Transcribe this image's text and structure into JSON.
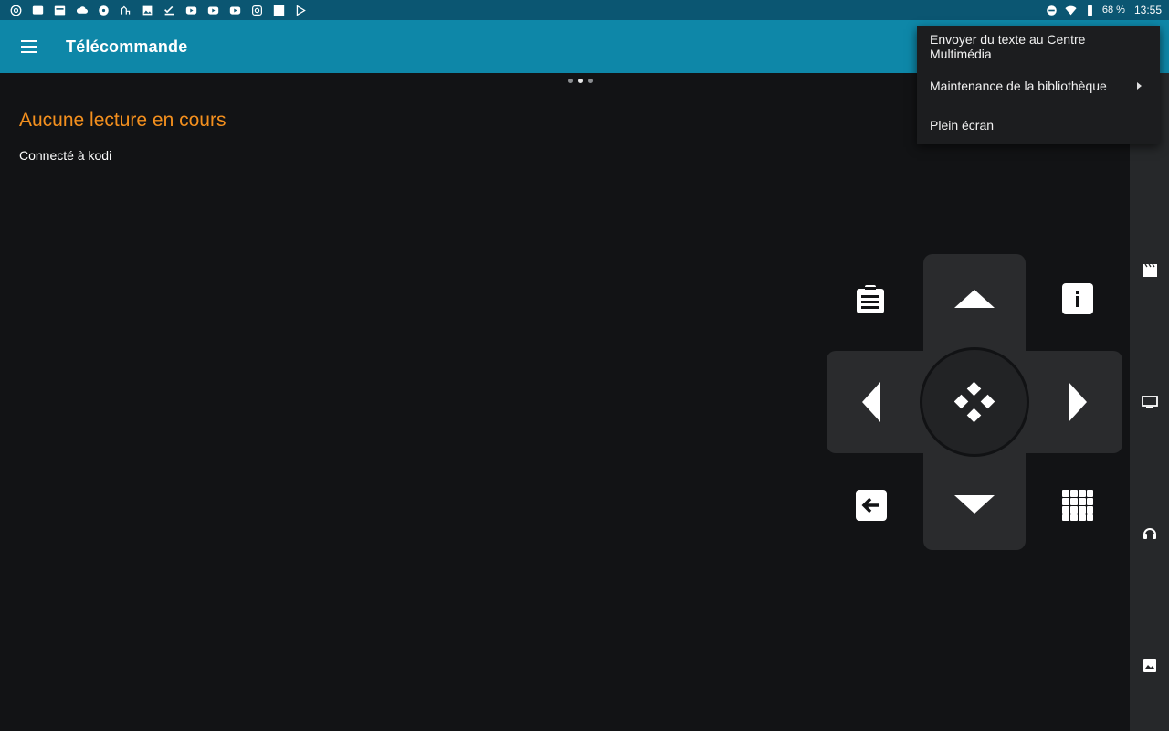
{
  "status_bar": {
    "icons": [
      "chrome-icon",
      "chat-icon",
      "news-icon",
      "cloud-icon",
      "circle-icon",
      "gesture-icon",
      "image-icon",
      "check-icon",
      "youtube-icon",
      "youtube-icon",
      "youtube-icon",
      "instagram-icon",
      "square-icon",
      "play-store-icon"
    ],
    "battery_percent": "68 %",
    "time": "13:55"
  },
  "app_bar": {
    "title": "Télécommande",
    "background_color": "#0e87a8"
  },
  "page_indicator": {
    "count": 3,
    "active_index": 1
  },
  "main": {
    "now_playing": "Aucune lecture en cours",
    "now_playing_color": "#f4901e",
    "connection_status": "Connecté à kodi"
  },
  "overflow_menu": {
    "items": [
      {
        "label": "Envoyer du texte au Centre Multimédia"
      },
      {
        "label": "Maintenance de la bibliothèque",
        "has_submenu": true
      },
      {
        "label": "Plein écran"
      }
    ]
  },
  "side_rail": {
    "icons": [
      "remote-icon",
      "movies-icon",
      "tv-icon",
      "music-icon",
      "pictures-icon"
    ]
  },
  "remote": {
    "buttons": [
      "playlist-icon",
      "up-arrow-icon",
      "info-icon",
      "left-arrow-icon",
      "select-icon",
      "right-arrow-icon",
      "back-icon",
      "down-arrow-icon",
      "keypad-icon"
    ]
  }
}
